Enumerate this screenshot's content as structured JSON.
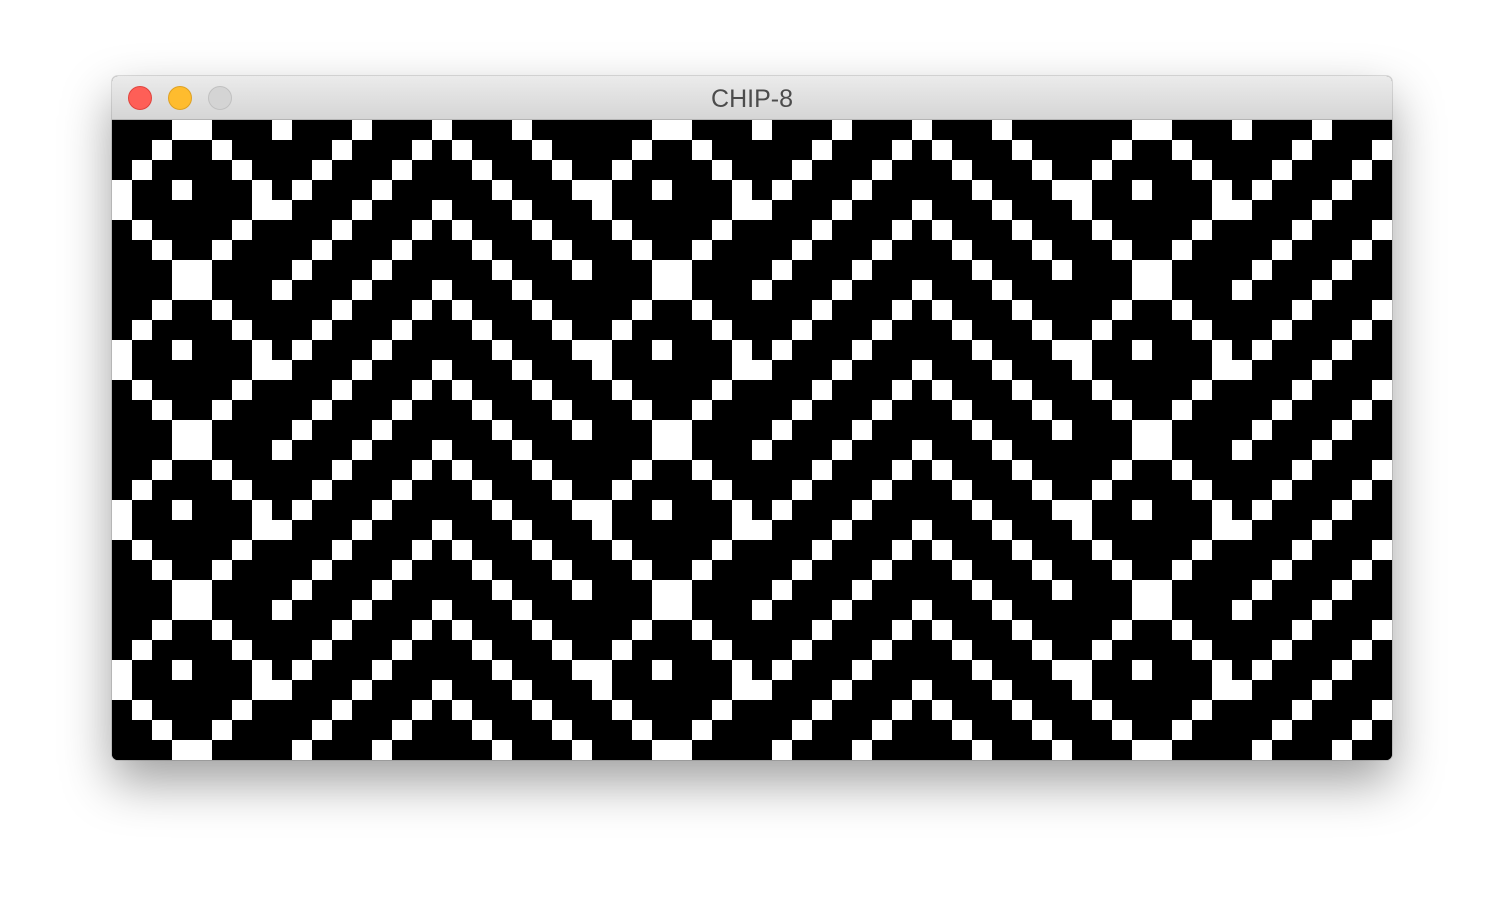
{
  "window": {
    "title": "CHIP-8",
    "controls": [
      "close",
      "minimize",
      "zoom"
    ],
    "colors": {
      "close": "#fe5f57",
      "minimize": "#febc2e",
      "zoom_disabled": "#d4d4d4"
    }
  },
  "display": {
    "resolution": "64x32",
    "background_color": "#000000",
    "pixel_color": "#ffffff"
  }
}
